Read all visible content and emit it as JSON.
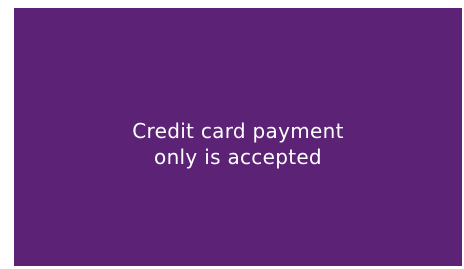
{
  "screen": {
    "background_color": "#5b2276",
    "text_color": "#ffffff",
    "message_lines": [
      "Credit card payment",
      "only is accepted"
    ]
  }
}
